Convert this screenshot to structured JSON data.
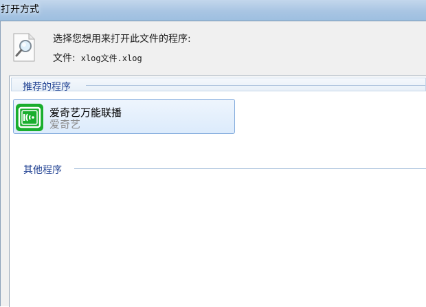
{
  "window": {
    "title": "打开方式"
  },
  "dialog": {
    "prompt": "选择您想用来打开此文件的程序:",
    "file_label": "文件:",
    "file_name": "xlog文件.xlog"
  },
  "groups": {
    "recommended": {
      "title": "推荐的程序",
      "items": [
        {
          "name": "爱奇艺万能联播",
          "company": "爱奇艺",
          "icon": "iqiyi-player-icon"
        }
      ]
    },
    "other": {
      "title": "其他程序"
    }
  },
  "colors": {
    "group_title": "#1e3f91",
    "icon_green": "#1aae2e",
    "selected_border": "#84acdd"
  }
}
